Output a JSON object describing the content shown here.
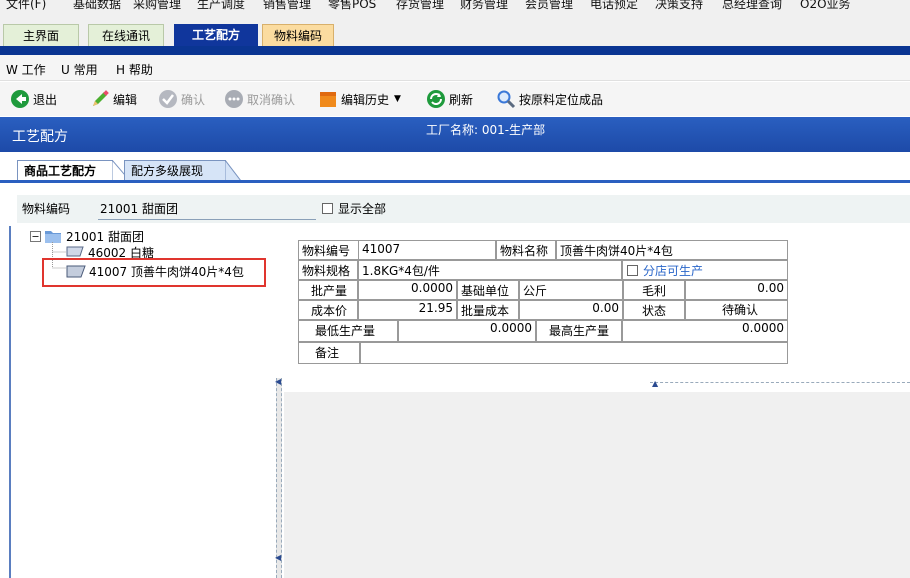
{
  "top_menu": {
    "items": [
      "文件(F)",
      "基础数据",
      "采购管理",
      "生产调度",
      "销售管理",
      "零售POS",
      "存货管理",
      "财务管理",
      "会员管理",
      "电话预定",
      "决策支持",
      "总经理查询",
      "O2O业务"
    ]
  },
  "tabs": [
    "主界面",
    "在线通讯",
    "工艺配方",
    "物料编码"
  ],
  "second_menu": [
    "W 工作",
    "U 常用",
    "H 帮助"
  ],
  "toolbar": {
    "exit": "退出",
    "edit": "编辑",
    "confirm": "确认",
    "unconfirm": "取消确认",
    "history": "编辑历史",
    "refresh": "刷新",
    "locate": "按原料定位成品"
  },
  "title": {
    "page": "工艺配方",
    "factory": "工厂名称: 001-生产部"
  },
  "subtabs": [
    "商品工艺配方",
    "配方多级展现"
  ],
  "filter": {
    "code_label": "物料编码",
    "code_value": "21001 甜面团",
    "show_all": "显示全部"
  },
  "tree": {
    "root": "21001 甜面团",
    "children": [
      "46002 白糖",
      "41007 顶善牛肉饼40片*4包"
    ]
  },
  "form": {
    "code_label": "物料编号",
    "code_value": "41007",
    "name_label": "物料名称",
    "name_value": "顶善牛肉饼40片*4包",
    "spec_label": "物料规格",
    "spec_value": "1.8KG*4包/件",
    "shop_label": "分店可生产",
    "batch_label": "批产量",
    "batch_value": "0.0000",
    "unit_label": "基础单位",
    "unit_value": "公斤",
    "margin_label": "毛利",
    "margin_value": "0.00",
    "cost_label": "成本价",
    "cost_value": "21.95",
    "batch_cost_label": "批量成本",
    "batch_cost_value": "0.00",
    "status_label": "状态",
    "status_value": "待确认",
    "min_label": "最低生产量",
    "min_value": "0.0000",
    "max_label": "最高生产量",
    "max_value": "0.0000",
    "note_label": "备注",
    "note_value": ""
  },
  "colors": {
    "accent": "#10369c",
    "title_bar": "#2a5fc0",
    "selection_highlight": "#e0352e"
  }
}
